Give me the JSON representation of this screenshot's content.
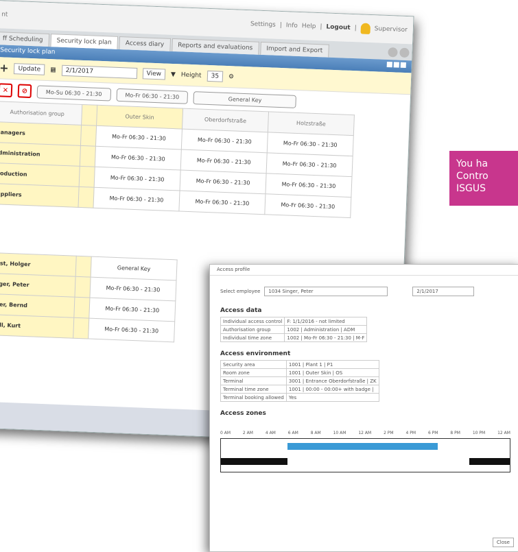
{
  "topbar": {
    "title": "nt",
    "settings": "Settings",
    "info": "Info",
    "help": "Help",
    "logout": "Logout",
    "user": "Supervisor"
  },
  "tabs": [
    "ff Scheduling",
    "Security lock plan",
    "Access diary",
    "Reports and evaluations",
    "Import and Export"
  ],
  "panel_title": "Security lock plan",
  "toolbar": {
    "update": "Update",
    "date": "2/1/2017",
    "view": "View",
    "height_label": "Height",
    "height_value": "35"
  },
  "filters": [
    "Mo-Su 06:30 - 21:30",
    "Mo-Fr 06:30 - 21:30",
    "General Key"
  ],
  "columns": {
    "group": "Authorisation group",
    "c1": "Outer Skin",
    "c2": "Oberdorfstraße",
    "c3": "Holzstraße"
  },
  "groups": [
    {
      "name": "Managers",
      "v": "Mo-Fr 06:30 - 21:30"
    },
    {
      "name": "Administration",
      "v": "Mo-Fr 06:30 - 21:30"
    },
    {
      "name": "Production",
      "v": "Mo-Fr 06:30 - 21:30"
    },
    {
      "name": "Suppliers",
      "v": "Mo-Fr 06:30 - 21:30"
    }
  ],
  "persons": [
    {
      "name": "Geist, Holger",
      "v": "General Key"
    },
    {
      "name": "Singer, Peter",
      "v": "Mo-Fr 06:30 - 21:30"
    },
    {
      "name": "Meier, Bernd",
      "v": "Mo-Fr 06:30 - 21:30"
    },
    {
      "name": "Knoll, Kurt",
      "v": "Mo-Fr 06:30 - 21:30"
    }
  ],
  "overlay": {
    "line1": "You ha",
    "line2": "Contro",
    "line3": "ISGUS"
  },
  "profile": {
    "title": "Access profile",
    "emp_label": "Select employee",
    "emp_value": "1034 Singer, Peter",
    "date": "2/1/2017",
    "access_data_title": "Access data",
    "access_data": [
      [
        "Individual access control",
        "F: 1/1/2016 - not limited"
      ],
      [
        "Authorisation group",
        "1002 | Administration | ADM"
      ],
      [
        "Individual time zone",
        "1002 | Mo-Fr 06:30 - 21:30 | M-F"
      ]
    ],
    "env_title": "Access environment",
    "env": [
      [
        "Security area",
        "1001 | Plant 1 | P1"
      ],
      [
        "Room zone",
        "1001 | Outer Skin | OS"
      ],
      [
        "Terminal",
        "3001 | Entrance Oberdorfstraße | ZK"
      ],
      [
        "Terminal time zone",
        "1001 | 00:00 - 00:00+ with badge |"
      ],
      [
        "Terminal booking allowed",
        "Yes"
      ]
    ],
    "zones_title": "Access zones",
    "hours": [
      "0 AM",
      "2 AM",
      "4 AM",
      "6 AM",
      "8 AM",
      "10 AM",
      "12 AM",
      "2 PM",
      "4 PM",
      "6 PM",
      "8 PM",
      "10 PM",
      "12 AM"
    ],
    "close": "Close"
  }
}
